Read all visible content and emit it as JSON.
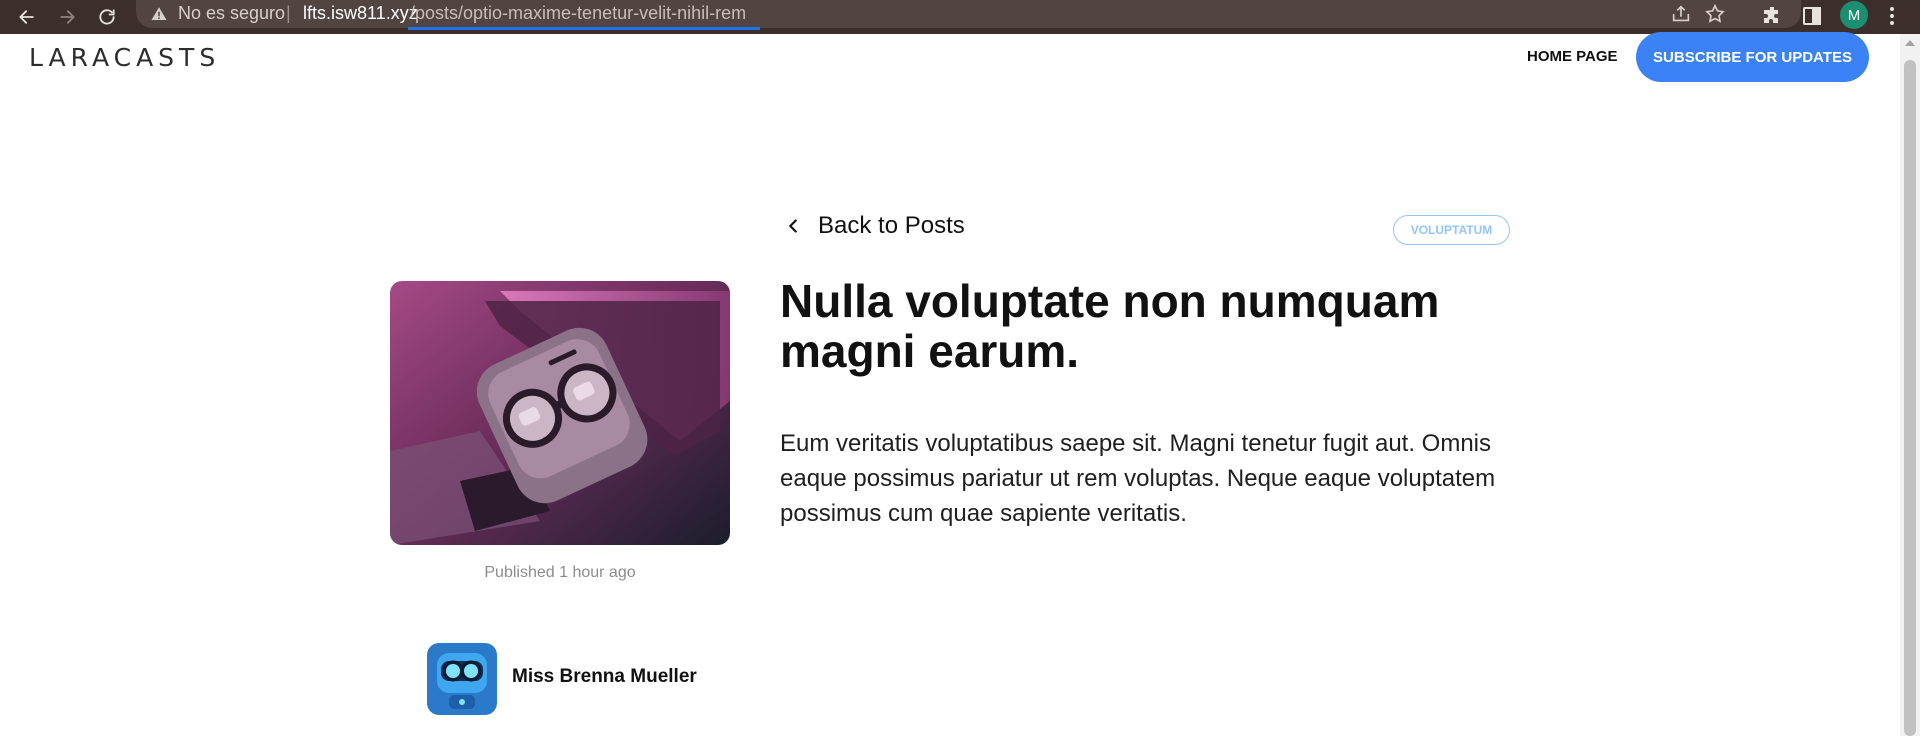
{
  "browser": {
    "security_label": "No es seguro",
    "separator": "|",
    "url_host": "lfts.isw811.xyz",
    "url_path": "/posts/optio-maxime-tenetur-velit-nihil-rem",
    "profile_initial": "M",
    "icons": [
      "back-arrow-icon",
      "forward-arrow-icon",
      "reload-icon",
      "warning-icon",
      "share-icon",
      "star-icon",
      "puzzle-icon",
      "side-panel-icon",
      "kebab-menu-icon"
    ]
  },
  "header": {
    "logo_text": "LARACASTS",
    "nav_home": "Home Page",
    "subscribe_label": "Subscribe for Updates"
  },
  "post": {
    "back_label": "Back to Posts",
    "category": "Voluptatum",
    "title": "Nulla voluptate non numquam magni earum.",
    "body": "Eum veritatis voluptatibus saepe sit. Magni tenetur fugit aut. Omnis eaque possimus pariatur ut rem voluptas. Neque eaque voluptatem possimus cum quae sapiente veritatis.",
    "published_prefix": "Published",
    "published_time": "1 hour ago",
    "author_name": "Miss Brenna Mueller"
  },
  "colors": {
    "accent": "#3b82f6",
    "tag_border": "#93c5fd",
    "chrome_bg": "#3c2f2b",
    "hero_pink": "#b24c8d",
    "hero_dark": "#1e2030"
  }
}
